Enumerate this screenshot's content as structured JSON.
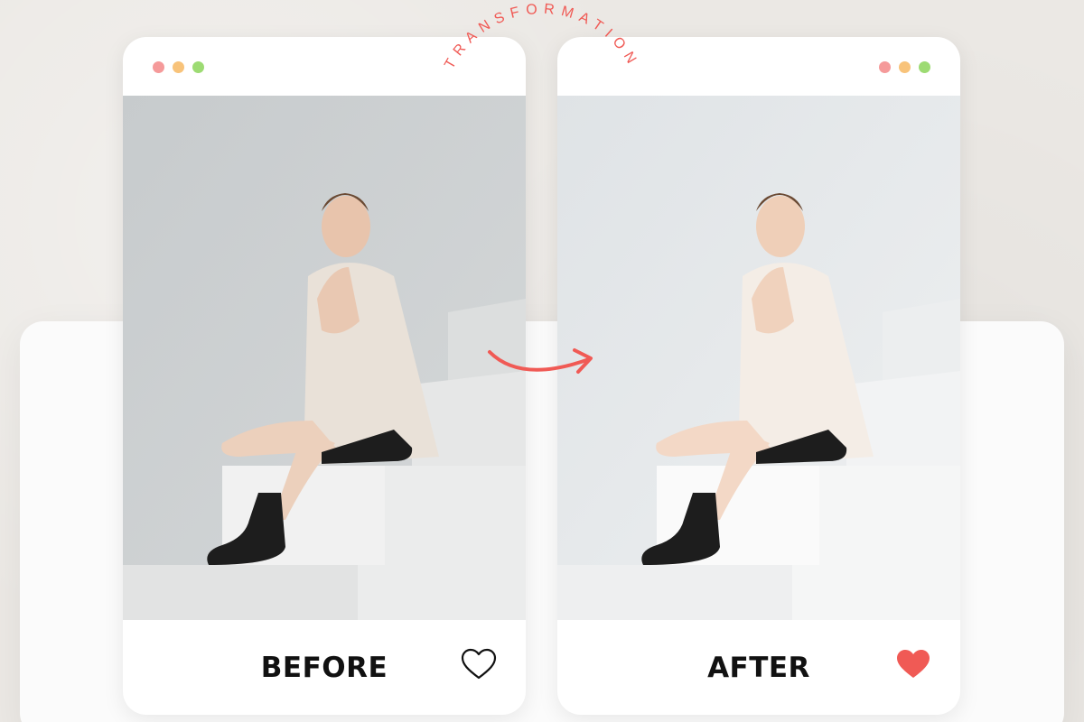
{
  "header": {
    "arc_title": "TRANSFORMATION"
  },
  "cards": {
    "before": {
      "caption": "BEFORE",
      "liked": false,
      "dots": [
        "#f59a9a",
        "#f8c37a",
        "#9ddb73"
      ]
    },
    "after": {
      "caption": "AFTER",
      "liked": true,
      "dots": [
        "#f59a9a",
        "#f8c37a",
        "#9ddb73"
      ]
    }
  },
  "icons": {
    "arrow": "curved-arrow-right-icon",
    "heart_outline": "heart-outline-icon",
    "heart_filled": "heart-filled-icon"
  },
  "colors": {
    "accent": "#f05a55",
    "background": "#ebe8e4",
    "card": "#ffffff",
    "text": "#111111"
  }
}
